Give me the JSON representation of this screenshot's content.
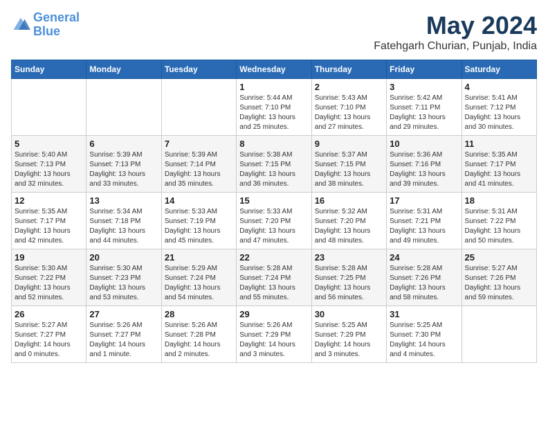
{
  "logo": {
    "line1": "General",
    "line2": "Blue"
  },
  "title": "May 2024",
  "subtitle": "Fatehgarh Churian, Punjab, India",
  "weekdays": [
    "Sunday",
    "Monday",
    "Tuesday",
    "Wednesday",
    "Thursday",
    "Friday",
    "Saturday"
  ],
  "weeks": [
    [
      {
        "day": "",
        "info": ""
      },
      {
        "day": "",
        "info": ""
      },
      {
        "day": "",
        "info": ""
      },
      {
        "day": "1",
        "info": "Sunrise: 5:44 AM\nSunset: 7:10 PM\nDaylight: 13 hours\nand 25 minutes."
      },
      {
        "day": "2",
        "info": "Sunrise: 5:43 AM\nSunset: 7:10 PM\nDaylight: 13 hours\nand 27 minutes."
      },
      {
        "day": "3",
        "info": "Sunrise: 5:42 AM\nSunset: 7:11 PM\nDaylight: 13 hours\nand 29 minutes."
      },
      {
        "day": "4",
        "info": "Sunrise: 5:41 AM\nSunset: 7:12 PM\nDaylight: 13 hours\nand 30 minutes."
      }
    ],
    [
      {
        "day": "5",
        "info": "Sunrise: 5:40 AM\nSunset: 7:13 PM\nDaylight: 13 hours\nand 32 minutes."
      },
      {
        "day": "6",
        "info": "Sunrise: 5:39 AM\nSunset: 7:13 PM\nDaylight: 13 hours\nand 33 minutes."
      },
      {
        "day": "7",
        "info": "Sunrise: 5:39 AM\nSunset: 7:14 PM\nDaylight: 13 hours\nand 35 minutes."
      },
      {
        "day": "8",
        "info": "Sunrise: 5:38 AM\nSunset: 7:15 PM\nDaylight: 13 hours\nand 36 minutes."
      },
      {
        "day": "9",
        "info": "Sunrise: 5:37 AM\nSunset: 7:15 PM\nDaylight: 13 hours\nand 38 minutes."
      },
      {
        "day": "10",
        "info": "Sunrise: 5:36 AM\nSunset: 7:16 PM\nDaylight: 13 hours\nand 39 minutes."
      },
      {
        "day": "11",
        "info": "Sunrise: 5:35 AM\nSunset: 7:17 PM\nDaylight: 13 hours\nand 41 minutes."
      }
    ],
    [
      {
        "day": "12",
        "info": "Sunrise: 5:35 AM\nSunset: 7:17 PM\nDaylight: 13 hours\nand 42 minutes."
      },
      {
        "day": "13",
        "info": "Sunrise: 5:34 AM\nSunset: 7:18 PM\nDaylight: 13 hours\nand 44 minutes."
      },
      {
        "day": "14",
        "info": "Sunrise: 5:33 AM\nSunset: 7:19 PM\nDaylight: 13 hours\nand 45 minutes."
      },
      {
        "day": "15",
        "info": "Sunrise: 5:33 AM\nSunset: 7:20 PM\nDaylight: 13 hours\nand 47 minutes."
      },
      {
        "day": "16",
        "info": "Sunrise: 5:32 AM\nSunset: 7:20 PM\nDaylight: 13 hours\nand 48 minutes."
      },
      {
        "day": "17",
        "info": "Sunrise: 5:31 AM\nSunset: 7:21 PM\nDaylight: 13 hours\nand 49 minutes."
      },
      {
        "day": "18",
        "info": "Sunrise: 5:31 AM\nSunset: 7:22 PM\nDaylight: 13 hours\nand 50 minutes."
      }
    ],
    [
      {
        "day": "19",
        "info": "Sunrise: 5:30 AM\nSunset: 7:22 PM\nDaylight: 13 hours\nand 52 minutes."
      },
      {
        "day": "20",
        "info": "Sunrise: 5:30 AM\nSunset: 7:23 PM\nDaylight: 13 hours\nand 53 minutes."
      },
      {
        "day": "21",
        "info": "Sunrise: 5:29 AM\nSunset: 7:24 PM\nDaylight: 13 hours\nand 54 minutes."
      },
      {
        "day": "22",
        "info": "Sunrise: 5:28 AM\nSunset: 7:24 PM\nDaylight: 13 hours\nand 55 minutes."
      },
      {
        "day": "23",
        "info": "Sunrise: 5:28 AM\nSunset: 7:25 PM\nDaylight: 13 hours\nand 56 minutes."
      },
      {
        "day": "24",
        "info": "Sunrise: 5:28 AM\nSunset: 7:26 PM\nDaylight: 13 hours\nand 58 minutes."
      },
      {
        "day": "25",
        "info": "Sunrise: 5:27 AM\nSunset: 7:26 PM\nDaylight: 13 hours\nand 59 minutes."
      }
    ],
    [
      {
        "day": "26",
        "info": "Sunrise: 5:27 AM\nSunset: 7:27 PM\nDaylight: 14 hours\nand 0 minutes."
      },
      {
        "day": "27",
        "info": "Sunrise: 5:26 AM\nSunset: 7:27 PM\nDaylight: 14 hours\nand 1 minute."
      },
      {
        "day": "28",
        "info": "Sunrise: 5:26 AM\nSunset: 7:28 PM\nDaylight: 14 hours\nand 2 minutes."
      },
      {
        "day": "29",
        "info": "Sunrise: 5:26 AM\nSunset: 7:29 PM\nDaylight: 14 hours\nand 3 minutes."
      },
      {
        "day": "30",
        "info": "Sunrise: 5:25 AM\nSunset: 7:29 PM\nDaylight: 14 hours\nand 3 minutes."
      },
      {
        "day": "31",
        "info": "Sunrise: 5:25 AM\nSunset: 7:30 PM\nDaylight: 14 hours\nand 4 minutes."
      },
      {
        "day": "",
        "info": ""
      }
    ]
  ]
}
